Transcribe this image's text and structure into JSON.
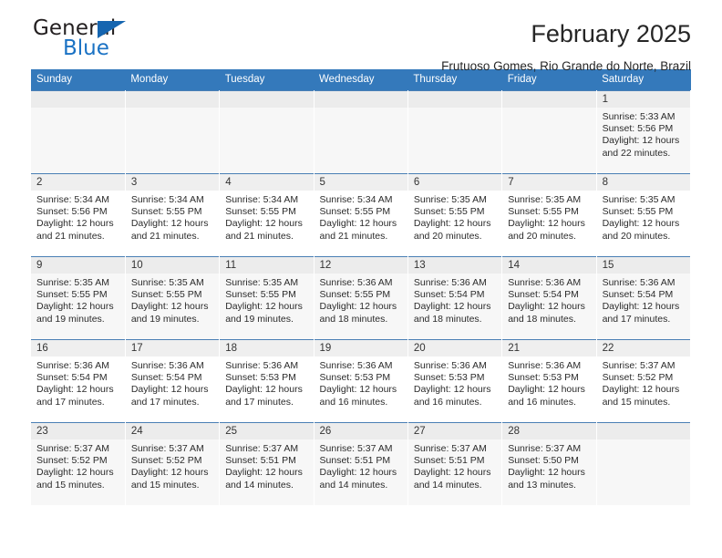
{
  "brand": {
    "name_top": "General",
    "name_bottom": "Blue",
    "triangle_color": "#1565b0",
    "blue_color": "#1a72c4"
  },
  "header": {
    "month_title": "February 2025",
    "location": "Frutuoso Gomes, Rio Grande do Norte, Brazil"
  },
  "theme": {
    "header_row_bg": "#3479bb",
    "header_row_text": "#ffffff",
    "daynum_bg": "#efefef",
    "row_divider": "#4a7fb5",
    "shaded_row_bg": "#f7f7f7"
  },
  "calendar": {
    "weekday_headers": [
      "Sunday",
      "Monday",
      "Tuesday",
      "Wednesday",
      "Thursday",
      "Friday",
      "Saturday"
    ],
    "weeks": [
      [
        {
          "day": "",
          "empty": true
        },
        {
          "day": "",
          "empty": true
        },
        {
          "day": "",
          "empty": true
        },
        {
          "day": "",
          "empty": true
        },
        {
          "day": "",
          "empty": true
        },
        {
          "day": "",
          "empty": true
        },
        {
          "day": "1",
          "sunrise": "Sunrise: 5:33 AM",
          "sunset": "Sunset: 5:56 PM",
          "daylight": "Daylight: 12 hours and 22 minutes."
        }
      ],
      [
        {
          "day": "2",
          "sunrise": "Sunrise: 5:34 AM",
          "sunset": "Sunset: 5:56 PM",
          "daylight": "Daylight: 12 hours and 21 minutes."
        },
        {
          "day": "3",
          "sunrise": "Sunrise: 5:34 AM",
          "sunset": "Sunset: 5:55 PM",
          "daylight": "Daylight: 12 hours and 21 minutes."
        },
        {
          "day": "4",
          "sunrise": "Sunrise: 5:34 AM",
          "sunset": "Sunset: 5:55 PM",
          "daylight": "Daylight: 12 hours and 21 minutes."
        },
        {
          "day": "5",
          "sunrise": "Sunrise: 5:34 AM",
          "sunset": "Sunset: 5:55 PM",
          "daylight": "Daylight: 12 hours and 21 minutes."
        },
        {
          "day": "6",
          "sunrise": "Sunrise: 5:35 AM",
          "sunset": "Sunset: 5:55 PM",
          "daylight": "Daylight: 12 hours and 20 minutes."
        },
        {
          "day": "7",
          "sunrise": "Sunrise: 5:35 AM",
          "sunset": "Sunset: 5:55 PM",
          "daylight": "Daylight: 12 hours and 20 minutes."
        },
        {
          "day": "8",
          "sunrise": "Sunrise: 5:35 AM",
          "sunset": "Sunset: 5:55 PM",
          "daylight": "Daylight: 12 hours and 20 minutes."
        }
      ],
      [
        {
          "day": "9",
          "sunrise": "Sunrise: 5:35 AM",
          "sunset": "Sunset: 5:55 PM",
          "daylight": "Daylight: 12 hours and 19 minutes."
        },
        {
          "day": "10",
          "sunrise": "Sunrise: 5:35 AM",
          "sunset": "Sunset: 5:55 PM",
          "daylight": "Daylight: 12 hours and 19 minutes."
        },
        {
          "day": "11",
          "sunrise": "Sunrise: 5:35 AM",
          "sunset": "Sunset: 5:55 PM",
          "daylight": "Daylight: 12 hours and 19 minutes."
        },
        {
          "day": "12",
          "sunrise": "Sunrise: 5:36 AM",
          "sunset": "Sunset: 5:55 PM",
          "daylight": "Daylight: 12 hours and 18 minutes."
        },
        {
          "day": "13",
          "sunrise": "Sunrise: 5:36 AM",
          "sunset": "Sunset: 5:54 PM",
          "daylight": "Daylight: 12 hours and 18 minutes."
        },
        {
          "day": "14",
          "sunrise": "Sunrise: 5:36 AM",
          "sunset": "Sunset: 5:54 PM",
          "daylight": "Daylight: 12 hours and 18 minutes."
        },
        {
          "day": "15",
          "sunrise": "Sunrise: 5:36 AM",
          "sunset": "Sunset: 5:54 PM",
          "daylight": "Daylight: 12 hours and 17 minutes."
        }
      ],
      [
        {
          "day": "16",
          "sunrise": "Sunrise: 5:36 AM",
          "sunset": "Sunset: 5:54 PM",
          "daylight": "Daylight: 12 hours and 17 minutes."
        },
        {
          "day": "17",
          "sunrise": "Sunrise: 5:36 AM",
          "sunset": "Sunset: 5:54 PM",
          "daylight": "Daylight: 12 hours and 17 minutes."
        },
        {
          "day": "18",
          "sunrise": "Sunrise: 5:36 AM",
          "sunset": "Sunset: 5:53 PM",
          "daylight": "Daylight: 12 hours and 17 minutes."
        },
        {
          "day": "19",
          "sunrise": "Sunrise: 5:36 AM",
          "sunset": "Sunset: 5:53 PM",
          "daylight": "Daylight: 12 hours and 16 minutes."
        },
        {
          "day": "20",
          "sunrise": "Sunrise: 5:36 AM",
          "sunset": "Sunset: 5:53 PM",
          "daylight": "Daylight: 12 hours and 16 minutes."
        },
        {
          "day": "21",
          "sunrise": "Sunrise: 5:36 AM",
          "sunset": "Sunset: 5:53 PM",
          "daylight": "Daylight: 12 hours and 16 minutes."
        },
        {
          "day": "22",
          "sunrise": "Sunrise: 5:37 AM",
          "sunset": "Sunset: 5:52 PM",
          "daylight": "Daylight: 12 hours and 15 minutes."
        }
      ],
      [
        {
          "day": "23",
          "sunrise": "Sunrise: 5:37 AM",
          "sunset": "Sunset: 5:52 PM",
          "daylight": "Daylight: 12 hours and 15 minutes."
        },
        {
          "day": "24",
          "sunrise": "Sunrise: 5:37 AM",
          "sunset": "Sunset: 5:52 PM",
          "daylight": "Daylight: 12 hours and 15 minutes."
        },
        {
          "day": "25",
          "sunrise": "Sunrise: 5:37 AM",
          "sunset": "Sunset: 5:51 PM",
          "daylight": "Daylight: 12 hours and 14 minutes."
        },
        {
          "day": "26",
          "sunrise": "Sunrise: 5:37 AM",
          "sunset": "Sunset: 5:51 PM",
          "daylight": "Daylight: 12 hours and 14 minutes."
        },
        {
          "day": "27",
          "sunrise": "Sunrise: 5:37 AM",
          "sunset": "Sunset: 5:51 PM",
          "daylight": "Daylight: 12 hours and 14 minutes."
        },
        {
          "day": "28",
          "sunrise": "Sunrise: 5:37 AM",
          "sunset": "Sunset: 5:50 PM",
          "daylight": "Daylight: 12 hours and 13 minutes."
        },
        {
          "day": "",
          "empty": true
        }
      ]
    ]
  }
}
